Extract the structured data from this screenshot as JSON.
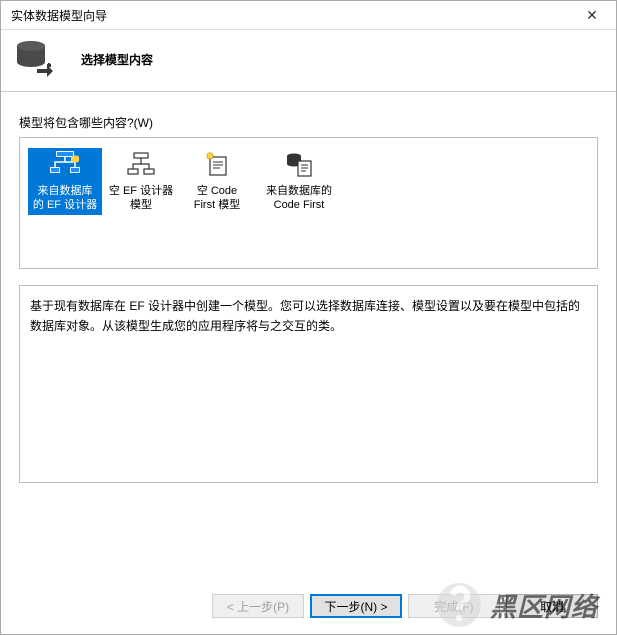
{
  "window": {
    "title": "实体数据模型向导",
    "close_glyph": "✕"
  },
  "header": {
    "title": "选择模型内容"
  },
  "prompt": "模型将包含哪些内容?(W)",
  "options": [
    {
      "line1": "来自数据库",
      "line2": "的 EF 设计器",
      "selected": true
    },
    {
      "line1": "空 EF 设计器",
      "line2": "模型",
      "selected": false
    },
    {
      "line1": "空 Code",
      "line2": "First 模型",
      "selected": false
    },
    {
      "line1": "来自数据库的",
      "line2": "Code First",
      "selected": false
    }
  ],
  "description": "基于现有数据库在 EF 设计器中创建一个模型。您可以选择数据库连接、模型设置以及要在模型中包括的数据库对象。从该模型生成您的应用程序将与之交互的类。",
  "buttons": {
    "prev": "< 上一步(P)",
    "next": "下一步(N) >",
    "finish": "完成(F)",
    "cancel": "取消"
  },
  "watermark": {
    "text": "黑区网络"
  }
}
